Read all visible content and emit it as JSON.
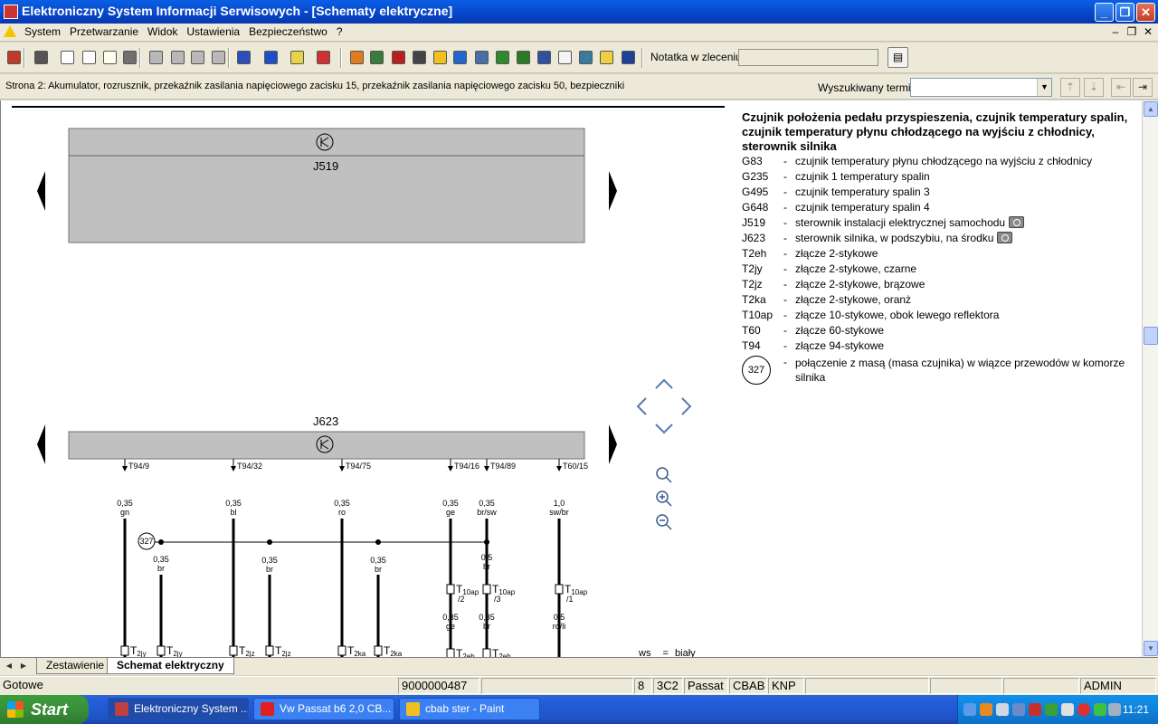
{
  "window": {
    "title": "Elektroniczny System Informacji Serwisowych - [Schematy elektryczne]",
    "controls": [
      "_",
      "❐",
      "✕"
    ]
  },
  "menu": {
    "items": [
      "System",
      "Przetwarzanie",
      "Widok",
      "Ustawienia",
      "Bezpieczeństwo",
      "?"
    ],
    "mdi_controls": [
      "–",
      "❐",
      "✕"
    ]
  },
  "toolbar": {
    "note_label": "Notatka w zleceniu:",
    "note_value": "",
    "tools": [
      {
        "icon": "exit-icon",
        "color": "#c0392b"
      },
      {
        "icon": "print-icon",
        "color": "#555555"
      },
      {
        "icon": "new-document-icon",
        "color": "#ffffff"
      },
      {
        "icon": "edit-document-icon",
        "color": "#ffffff"
      },
      {
        "icon": "document-list-icon",
        "color": "#ffffee"
      },
      {
        "icon": "car-icon",
        "color": "#707070"
      },
      {
        "icon": "first-page-icon",
        "color": "#b8b8b8"
      },
      {
        "icon": "previous-page-icon",
        "color": "#b8b8b8"
      },
      {
        "icon": "next-page-icon",
        "color": "#b8b8b8"
      },
      {
        "icon": "last-page-icon",
        "color": "#b8b8b8"
      },
      {
        "icon": "jump-icon",
        "color": "#2a4fb8"
      },
      {
        "icon": "info-icon",
        "color": "#1f4fc8"
      },
      {
        "icon": "help-icon",
        "color": "#e8d24a"
      },
      {
        "icon": "swap-icon",
        "color": "#d03030"
      },
      {
        "icon": "modules-icon",
        "color": "#e07b20"
      },
      {
        "icon": "technician-icon",
        "color": "#3a7a3a"
      },
      {
        "icon": "manual-icon",
        "color": "#b82020"
      },
      {
        "icon": "list-icon",
        "color": "#444444"
      },
      {
        "icon": "warning-icon",
        "color": "#f0c020"
      },
      {
        "icon": "globe-icon",
        "color": "#2266cc"
      },
      {
        "icon": "calculator-icon",
        "color": "#4a6fa8"
      },
      {
        "icon": "book-icon",
        "color": "#2f8a2f"
      },
      {
        "icon": "vehicle-icon",
        "color": "#2a7a2a"
      },
      {
        "icon": "diagnosis-icon",
        "color": "#3050a0"
      },
      {
        "icon": "checklist-icon",
        "color": "#f4f4f4"
      },
      {
        "icon": "notes-icon",
        "color": "#3a7a9a"
      },
      {
        "icon": "question-doc-icon",
        "color": "#f0d040"
      },
      {
        "icon": "menu-lines-icon",
        "color": "#1e3f9a"
      }
    ]
  },
  "infobar": {
    "page_description": "Strona 2: Akumulator, rozrusznik, przekaźnik zasilania napięciowego zacisku 15, przekaźnik zasilania napięciowego zacisku 50, bezpieczniki",
    "search_label": "Wyszukiwany termin:",
    "search_value": ""
  },
  "schematic": {
    "upper_component": "J519",
    "lower_component": "J623",
    "ground_point": "327",
    "pins": [
      {
        "label": "T94/9",
        "gauge": "0,35",
        "color": "gn"
      },
      {
        "label": "T94/32",
        "gauge": "0,35",
        "color": "bl"
      },
      {
        "label": "T94/75",
        "gauge": "0,35",
        "color": "ro"
      },
      {
        "label": "T94/16",
        "gauge": "0,35",
        "color": "ge"
      },
      {
        "label": "T94/89",
        "gauge": "0,35",
        "color": "br/sw"
      },
      {
        "label": "T60/15",
        "gauge": "1,0",
        "color": "sw/br"
      }
    ],
    "ground_wires": [
      {
        "gauge": "0,35",
        "color": "br"
      },
      {
        "gauge": "0,35",
        "color": "br"
      },
      {
        "gauge": "0,35",
        "color": "br"
      },
      {
        "gauge": "0,5",
        "color": "br"
      }
    ],
    "connectors": [
      {
        "label": "T2jy",
        "main": "T",
        "sub": "2jy"
      },
      {
        "label": "T2jy",
        "main": "T",
        "sub": "2jy"
      },
      {
        "label": "T2jz",
        "main": "T",
        "sub": "2jz"
      },
      {
        "label": "T2jz",
        "main": "T",
        "sub": "2jz"
      },
      {
        "label": "T2ka",
        "main": "T",
        "sub": "2ka"
      },
      {
        "label": "T2ka",
        "main": "T",
        "sub": "2ka"
      },
      {
        "label": "T10ap /2",
        "main": "T",
        "sub": "10ap",
        "pin": "/2"
      },
      {
        "label": "T10ap /3",
        "main": "T",
        "sub": "10ap",
        "pin": "/3"
      },
      {
        "label": "T10ap /1",
        "main": "T",
        "sub": "10ap",
        "pin": "/1"
      },
      {
        "label": "T2eh",
        "main": "T",
        "sub": "2eh"
      },
      {
        "label": "T2eh",
        "main": "T",
        "sub": "2eh"
      }
    ],
    "after_connector_wires": [
      {
        "gauge": "0,35",
        "color": "ge"
      },
      {
        "gauge": "0,35",
        "color": "br"
      },
      {
        "gauge": "0,5",
        "color": "ro/li"
      }
    ],
    "color_key": {
      "code": "ws",
      "eq": "=",
      "name": "biały"
    }
  },
  "legend": {
    "title": "Czujnik położenia pedału przyspieszenia, czujnik temperatury spalin, czujnik temperatury płynu chłodzącego na wyjściu z chłodnicy, sterownik silnika",
    "entries": [
      {
        "code": "G83",
        "desc": "czujnik temperatury płynu chłodzącego na wyjściu z chłodnicy",
        "photo": false
      },
      {
        "code": "G235",
        "desc": "czujnik 1 temperatury spalin",
        "photo": false
      },
      {
        "code": "G495",
        "desc": "czujnik temperatury spalin 3",
        "photo": false
      },
      {
        "code": "G648",
        "desc": "czujnik temperatury spalin 4",
        "photo": false
      },
      {
        "code": "J519",
        "desc": "sterownik instalacji elektrycznej samochodu",
        "photo": true
      },
      {
        "code": "J623",
        "desc": "sterownik silnika, w podszybiu, na środku",
        "photo": true
      },
      {
        "code": "T2eh",
        "desc": "złącze 2-stykowe",
        "photo": false
      },
      {
        "code": "T2jy",
        "desc": "złącze 2-stykowe, czarne",
        "photo": false
      },
      {
        "code": "T2jz",
        "desc": "złącze 2-stykowe, brązowe",
        "photo": false
      },
      {
        "code": "T2ka",
        "desc": "złącze 2-stykowe, oranż",
        "photo": false
      },
      {
        "code": "T10ap",
        "desc": "złącze 10-stykowe, obok lewego reflektora",
        "photo": false
      },
      {
        "code": "T60",
        "desc": "złącze 60-stykowe",
        "photo": false
      },
      {
        "code": "T94",
        "desc": "złącze 94-stykowe",
        "photo": false
      }
    ],
    "ground": {
      "code": "327",
      "desc": "połączenie z masą (masa czujnika) w wiązce przewodów w komorze silnika"
    }
  },
  "dash": "-",
  "tabs": {
    "items": [
      {
        "label": "Zestawienie",
        "active": false
      },
      {
        "label": "Schemat elektryczny",
        "active": true
      }
    ]
  },
  "statusbar": {
    "status": "Gotowe",
    "order_number": "9000000487",
    "field_a": "8",
    "field_b": "3C2",
    "model": "Passat",
    "engine": "CBAB",
    "gearbox": "KNP",
    "user": "ADMIN"
  },
  "taskbar": {
    "start_label": "Start",
    "tasks": [
      {
        "label": "Elektroniczny System ...",
        "active": true,
        "color": "#c04040"
      },
      {
        "label": "Vw Passat b6 2,0 CB...",
        "active": false,
        "color": "#e02020"
      },
      {
        "label": "cbab ster - Paint",
        "active": false,
        "color": "#f0c020"
      }
    ],
    "clock": "11:21"
  }
}
